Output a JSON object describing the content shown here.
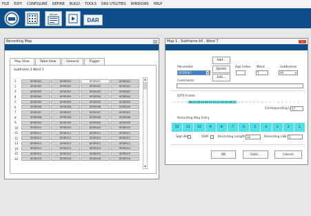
{
  "menu": [
    "FILE",
    "EDIT",
    "CONFIGURE",
    "DEFINE",
    "BUILD",
    "TOOLS",
    "DBX UTILITIES",
    "WINDOWS",
    "HELP"
  ],
  "toolbar": {
    "report_label": "REPORT",
    "dar_label": "DAR"
  },
  "left_pane": {
    "title": "Recording Map",
    "tabs": [
      "Map View",
      "Table View",
      "General",
      "Trigger"
    ],
    "subtitle": "Subframe 3 Word 1",
    "rows": [
      {
        "n": "1",
        "c": [
          "DFDR001",
          "DFDR001",
          "DFDR001",
          "DFDR001"
        ]
      },
      {
        "n": "2",
        "c": [
          "DFDR002",
          "DFDR002",
          "DFDR002",
          "DFDR002"
        ]
      },
      {
        "n": "3",
        "c": [
          "DFDR003",
          "DFDR003",
          "DFDR003",
          "DFDR003"
        ]
      },
      {
        "n": "4",
        "c": [
          "DFDR004",
          "DFDR004",
          "DFDR004",
          "DFDR004"
        ]
      },
      {
        "n": "5",
        "c": [
          "DFDR005",
          "DFDR005",
          "DFDR005",
          "DFDR005"
        ]
      },
      {
        "n": "6",
        "c": [
          "DFDR006",
          "DFDR006",
          "DFDR006",
          "DFDR006"
        ]
      },
      {
        "n": "7",
        "c": [
          "DFDR007",
          "DFDR007",
          "DFDR007",
          "DFDR007"
        ]
      },
      {
        "n": "8",
        "c": [
          "DFDR008",
          "DFDR008",
          "DFDR008",
          "DFDR008"
        ]
      },
      {
        "n": "9",
        "c": [
          "DFDR009",
          "DFDR009",
          "DFDR009",
          "DFDR009"
        ]
      },
      {
        "n": "10",
        "c": [
          "DFDR010",
          "DFDR010",
          "DFDR010",
          "DFDR010"
        ]
      },
      {
        "n": "11",
        "c": [
          "DFDR011",
          "DFDR011",
          "DFDR011",
          "DFDR011"
        ]
      },
      {
        "n": "12",
        "c": [
          "DFDR012",
          "DFDR012",
          "DFDR012",
          "DFDR012"
        ]
      },
      {
        "n": "13",
        "c": [
          "DFDR013",
          "DFDR013",
          "DFDR013",
          "DFDR013"
        ]
      },
      {
        "n": "14",
        "c": [
          "DFDR014",
          "DFDR014",
          "DFDR014",
          "DFDR014"
        ]
      },
      {
        "n": "15",
        "c": [
          "DFDR015",
          "DFDR015",
          "DFDR015",
          "DFDR015"
        ]
      },
      {
        "n": "16",
        "c": [
          "DFDR016",
          "DFDR016",
          "DFDR016",
          "DFDR016"
        ]
      }
    ]
  },
  "right_pane": {
    "title": "Map 1 , Subframe All , Word 7",
    "parameter_label": "Parameter",
    "parameter_value": "DFDR007",
    "add_label": "Add...",
    "delete_label": "Delete",
    "edit_label": "Edit...",
    "age_index_label": "Age Index",
    "age_index_value": "",
    "word_label": "Word",
    "word_value": "7",
    "subframes_label": "Subframes",
    "subframes_value": "All",
    "comments_label": "Comments",
    "comments_value": "",
    "dts_label": "DITS Frame",
    "dts_bits": [
      "32",
      "31",
      "30",
      "29",
      "28",
      "27",
      "26",
      "25",
      "24",
      "23",
      "22",
      "21",
      "20",
      "19",
      "18",
      "17",
      "16",
      "15",
      "14",
      "13",
      "12",
      "11",
      "10",
      "9",
      "8",
      "7",
      "6",
      "5",
      "4",
      "3",
      "2",
      "1"
    ],
    "corresponding_label": "Corresponding LSB:",
    "corresponding_value": "17",
    "entry_label": "Recording Map Entry",
    "entry_bits": [
      "12",
      "11",
      "10",
      "9",
      "8",
      "7",
      "6",
      "5",
      "4",
      "3",
      "2",
      "1"
    ],
    "sign_bit_label": "Sign Bit:",
    "ssm_label": "SSM:",
    "rec_length_label": "Recording Length:",
    "rec_length_value": "12",
    "rec_lsb_label": "Recording LSB:",
    "rec_lsb_value": "1",
    "ok_label": "OK",
    "goto_label": "Goto...",
    "cancel_label": "Cancel"
  },
  "colors": {
    "toolbar_bg": "#0e4d8a",
    "highlight": "#52e0e8",
    "close_button": "#d24b2c"
  }
}
